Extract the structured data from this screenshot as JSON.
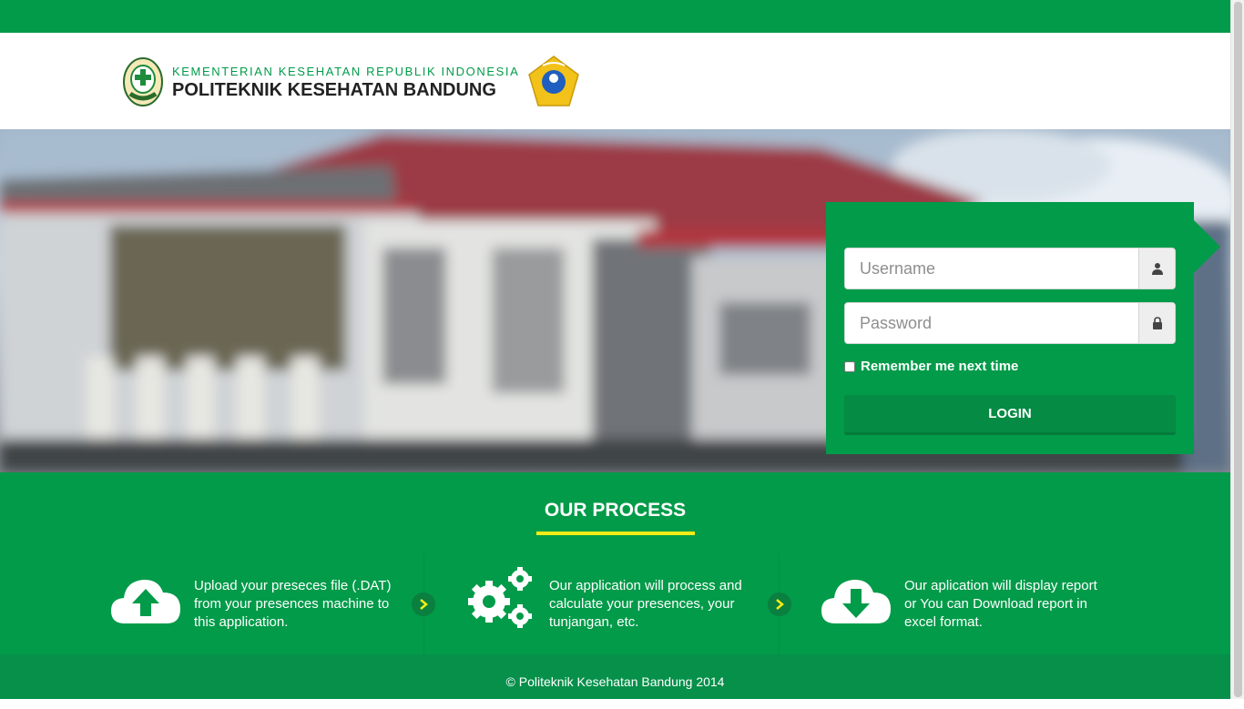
{
  "header": {
    "ministry": "KEMENTERIAN KESEHATAN REPUBLIK INDONESIA",
    "institution": "POLITEKNIK KESEHATAN BANDUNG"
  },
  "login": {
    "username_placeholder": "Username",
    "password_placeholder": "Password",
    "remember_label": "Remember me next time",
    "button_label": "LOGIN"
  },
  "process": {
    "title": "OUR PROCESS",
    "steps": [
      {
        "text": "Upload your preseces file (.DAT) from your presences machine to this application.",
        "icon": "cloud-upload-icon"
      },
      {
        "text": "Our application will process and calculate your presences, your tunjangan, etc.",
        "icon": "gears-icon"
      },
      {
        "text": "Our aplication will display report or You can Download report in excel format.",
        "icon": "cloud-download-icon"
      }
    ]
  },
  "footer": {
    "copyright": "© Politeknik Kesehatan Bandung 2014"
  },
  "colors": {
    "brand_green": "#019b49",
    "accent_yellow": "#f6eb16"
  }
}
